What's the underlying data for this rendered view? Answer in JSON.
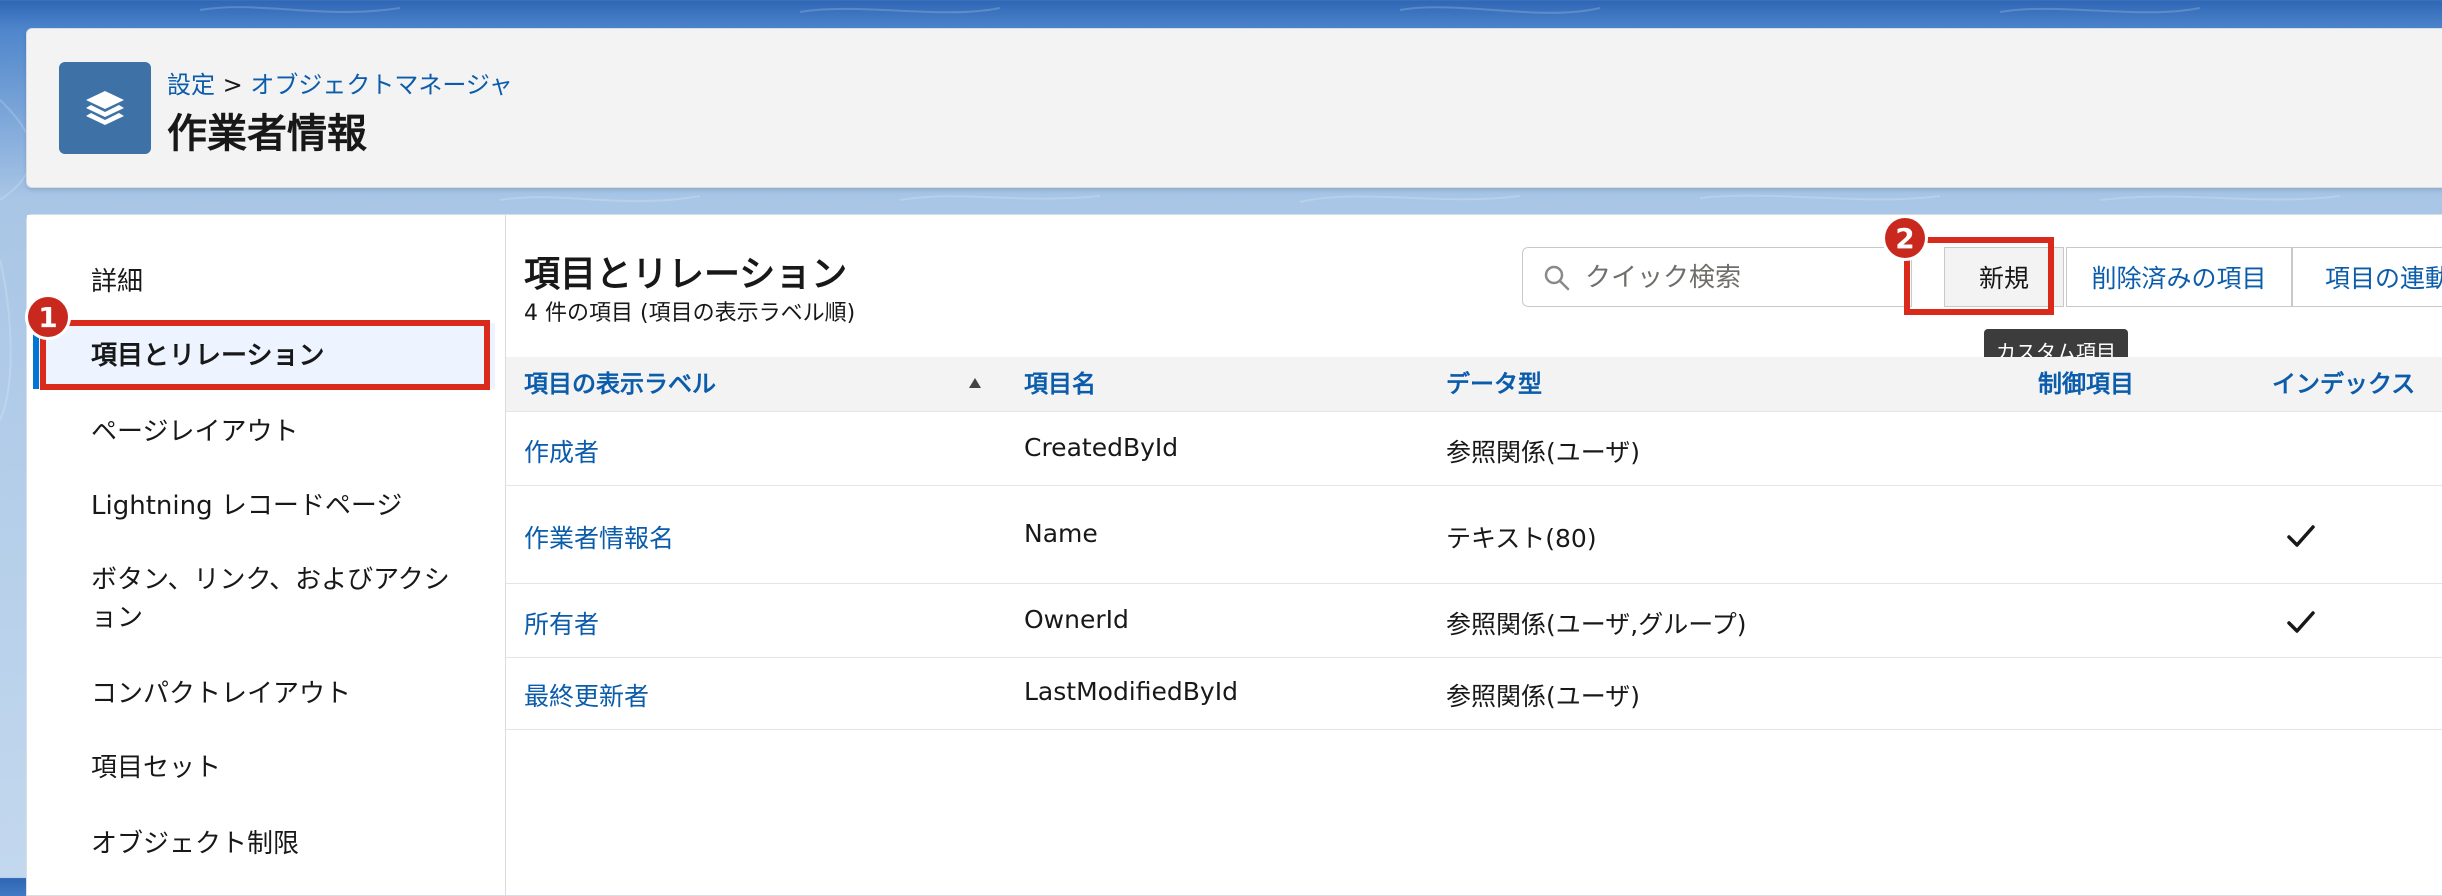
{
  "breadcrumb": {
    "setup": "設定",
    "separator": ">",
    "object_manager": "オブジェクトマネージャ"
  },
  "page_title": "作業者情報",
  "app_icon": "layers-icon",
  "sidebar": {
    "items": [
      {
        "label": "詳細"
      },
      {
        "label": "項目とリレーション",
        "active": true
      },
      {
        "label": "ページレイアウト"
      },
      {
        "label": "Lightning レコードページ"
      },
      {
        "label": "ボタン、リンク、およびアクション"
      },
      {
        "label": "コンパクトレイアウト"
      },
      {
        "label": "項目セット"
      },
      {
        "label": "オブジェクト制限"
      }
    ]
  },
  "main": {
    "title": "項目とリレーション",
    "subtitle": "4 件の項目 (項目の表示ラベル順)",
    "search_placeholder": "クイック検索",
    "buttons": {
      "new": "新規",
      "deleted_fields": "削除済みの項目",
      "field_dependencies": "項目の連動"
    },
    "tooltip": "カスタム項目",
    "annotations": {
      "badge1": "1",
      "badge2": "2"
    },
    "table": {
      "columns": [
        "項目の表示ラベル",
        "項目名",
        "データ型",
        "制御項目",
        "インデックス"
      ],
      "rows": [
        {
          "label": "作成者",
          "name": "CreatedById",
          "type": "参照関係(ユーザ)",
          "control": "",
          "indexed": false
        },
        {
          "label": "作業者情報名",
          "name": "Name",
          "type": "テキスト(80)",
          "control": "",
          "indexed": true
        },
        {
          "label": "所有者",
          "name": "OwnerId",
          "type": "参照関係(ユーザ,グループ)",
          "control": "",
          "indexed": true
        },
        {
          "label": "最終更新者",
          "name": "LastModifiedById",
          "type": "参照関係(ユーザ)",
          "control": "",
          "indexed": false
        }
      ]
    }
  },
  "colors": {
    "link": "#0b5cab",
    "highlight": "#d92a1c",
    "active_bar": "#0176d3"
  }
}
